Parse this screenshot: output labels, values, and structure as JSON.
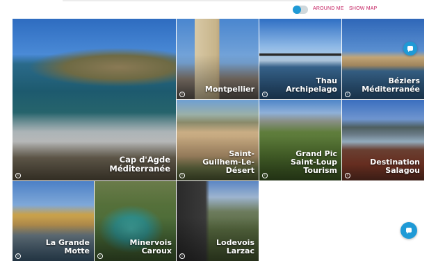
{
  "toggle": {
    "label": "AROUND ME",
    "state": "off"
  },
  "show_map": "SHOW MAP",
  "colors": {
    "accent": "#1f9ad6",
    "link": "#c2185b"
  },
  "info_glyph": "i",
  "tiles": [
    {
      "name": "tile-cap-d-agde",
      "lines": [
        "Cap d'Agde",
        "Méditerranée"
      ]
    },
    {
      "name": "tile-montpellier",
      "lines": [
        "Montpellier"
      ]
    },
    {
      "name": "tile-thau-archipelago",
      "lines": [
        "Thau",
        "Archipelago"
      ]
    },
    {
      "name": "tile-beziers-mediterranee",
      "lines": [
        "Béziers",
        "Méditerranée"
      ]
    },
    {
      "name": "tile-saint-guilhem-le-desert",
      "lines": [
        "Saint-",
        "Guilhem-Le-",
        "Désert"
      ]
    },
    {
      "name": "tile-grand-pic-saint-loup",
      "lines": [
        "Grand Pic",
        "Saint-Loup",
        "Tourism"
      ]
    },
    {
      "name": "tile-destination-salagou",
      "lines": [
        "Destination",
        "Salagou"
      ]
    },
    {
      "name": "tile-la-grande-motte",
      "lines": [
        "La Grande",
        "Motte"
      ]
    },
    {
      "name": "tile-minervois-caroux",
      "lines": [
        "Minervois",
        "Caroux"
      ]
    },
    {
      "name": "tile-lodevois-larzac",
      "lines": [
        "Lodevois",
        "Larzac"
      ]
    }
  ]
}
